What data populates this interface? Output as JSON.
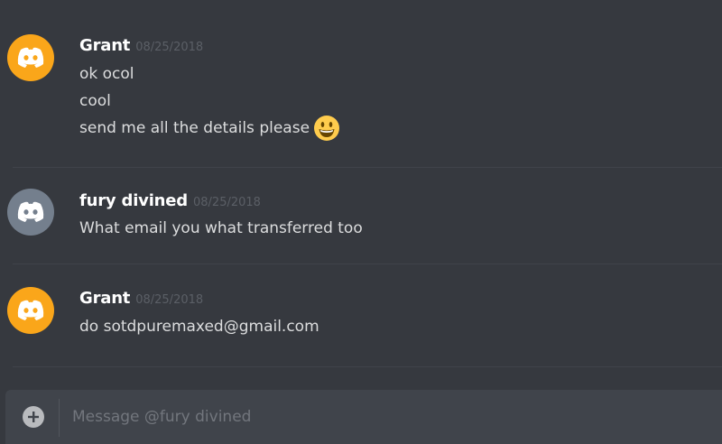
{
  "colors": {
    "background": "#36393f",
    "avatar_orange": "#faa61a",
    "avatar_grey": "#747f8d",
    "username": "#ffffff",
    "timestamp": "#5b5f66",
    "message_text": "#dcddde"
  },
  "messages": [
    {
      "username": "Grant",
      "timestamp": "08/25/2018",
      "avatar_icon": "discord-logo-icon",
      "avatar_color": "#faa61a",
      "lines": [
        "ok ocol",
        "cool",
        "send me all the details please"
      ],
      "emoji": "grinning-face-emoji"
    },
    {
      "username": "fury divined",
      "timestamp": "08/25/2018",
      "avatar_icon": "discord-logo-icon",
      "avatar_color": "#747f8d",
      "lines": [
        "What email you what transferred too"
      ]
    },
    {
      "username": "Grant",
      "timestamp": "08/25/2018",
      "avatar_icon": "discord-logo-icon",
      "avatar_color": "#faa61a",
      "lines": [
        "do sotdpuremaxed@gmail.com"
      ]
    }
  ],
  "composer": {
    "placeholder": "Message @fury divined",
    "value": "",
    "attach_icon": "plus-circle-icon"
  }
}
